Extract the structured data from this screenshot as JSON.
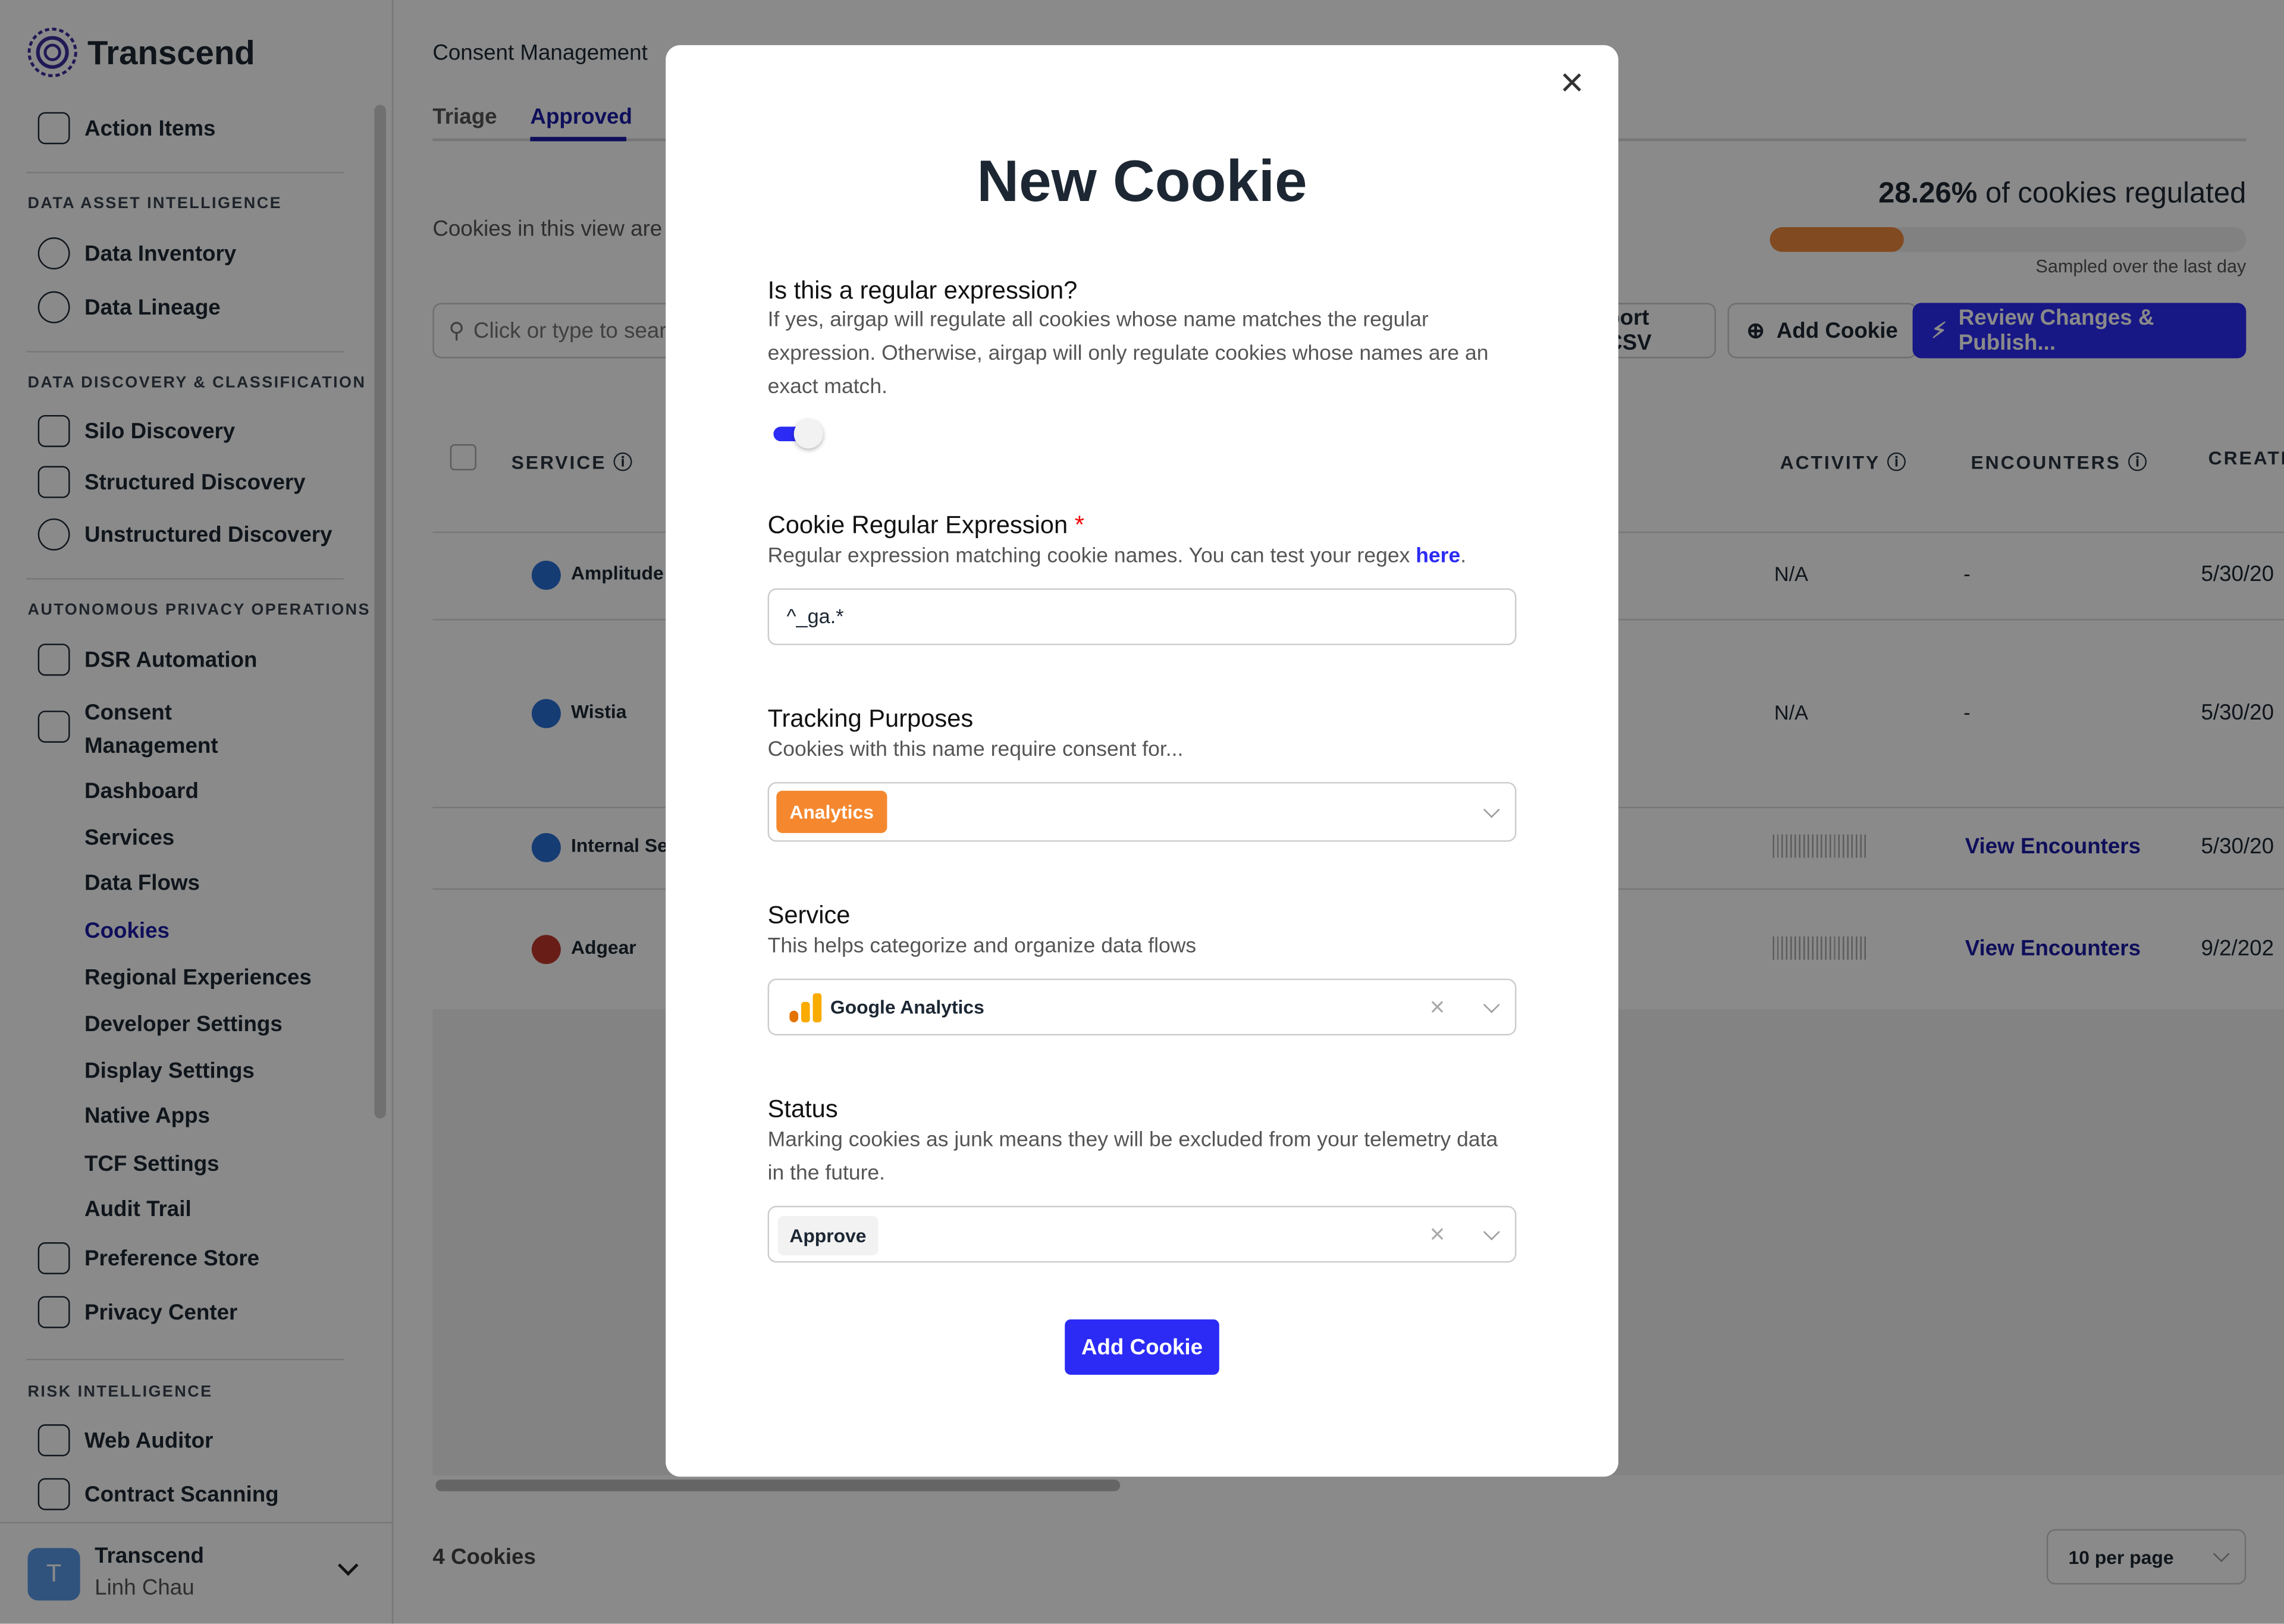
{
  "sidebar": {
    "brand": "Transcend",
    "action_items": "Action Items",
    "sections": [
      {
        "title": "DATA ASSET INTELLIGENCE",
        "items": [
          "Data Inventory",
          "Data Lineage"
        ]
      },
      {
        "title": "DATA DISCOVERY & CLASSIFICATION",
        "items": [
          "Silo Discovery",
          "Structured Discovery",
          "Unstructured Discovery"
        ]
      },
      {
        "title": "AUTONOMOUS PRIVACY OPERATIONS",
        "items": [
          "DSR Automation",
          "Consent Management",
          "Preference Store",
          "Privacy Center"
        ]
      },
      {
        "title": "RISK INTELLIGENCE",
        "items": [
          "Web Auditor",
          "Contract Scanning"
        ]
      }
    ],
    "consent_sub": [
      "Dashboard",
      "Services",
      "Data Flows",
      "Cookies",
      "Regional Experiences",
      "Developer Settings",
      "Display Settings",
      "Native Apps",
      "TCF Settings",
      "Audit Trail"
    ],
    "active_sub": "Cookies",
    "user": {
      "org": "Transcend",
      "name": "Linh Chau",
      "initial": "T"
    }
  },
  "main": {
    "breadcrumb": "Consent Management",
    "tabs": [
      "Triage",
      "Approved"
    ],
    "active_tab": "Approved",
    "description": "Cookies in this view are ac",
    "regulated": {
      "percent": "28.26%",
      "label": "of cookies regulated",
      "value": 28.26,
      "sub": "Sampled over the last day"
    },
    "search_placeholder": "Click or type to search",
    "buttons": {
      "export": "port CSV",
      "add": "Add Cookie",
      "publish": "Review Changes & Publish..."
    },
    "columns": [
      "SERVICE",
      "ACTIVITY",
      "ENCOUNTERS",
      "CREATE"
    ],
    "rows": [
      {
        "service": "Amplitude",
        "activity": "N/A",
        "encounters": "-",
        "created": "5/30/20"
      },
      {
        "service": "Wistia",
        "activity": "N/A",
        "encounters": "-",
        "created": "5/30/20"
      },
      {
        "service": "Internal Ser",
        "activity": "",
        "encounters": "View Encounters",
        "created": "5/30/20"
      },
      {
        "service": "Adgear",
        "activity": "",
        "encounters": "View Encounters",
        "created": "9/2/202"
      }
    ],
    "count": "4 Cookies",
    "per_page": "10 per page"
  },
  "modal": {
    "title": "New Cookie",
    "regex_q": "Is this a regular expression?",
    "regex_help": "If yes, airgap will regulate all cookies whose name matches the regular expression. Otherwise, airgap will only regulate cookies whose names are an exact match.",
    "regex_on": true,
    "expr_label": "Cookie Regular Expression",
    "required": "*",
    "expr_help": "Regular expression matching cookie names. You can test your regex ",
    "expr_link": "here",
    "expr_value": "^_ga.*",
    "purposes_label": "Tracking Purposes",
    "purposes_help": "Cookies with this name require consent for...",
    "purpose_tag": "Analytics",
    "service_label": "Service",
    "service_help": "This helps categorize and organize data flows",
    "service_value": "Google Analytics",
    "status_label": "Status",
    "status_help": "Marking cookies as junk means they will be excluded from your telemetry data in the future.",
    "status_value": "Approve",
    "submit": "Add Cookie"
  },
  "colors": {
    "accent": "#2b2bf5",
    "nav_active": "#1a1aa8",
    "analytics": "#f5882f",
    "progress": "#f08a3c"
  }
}
